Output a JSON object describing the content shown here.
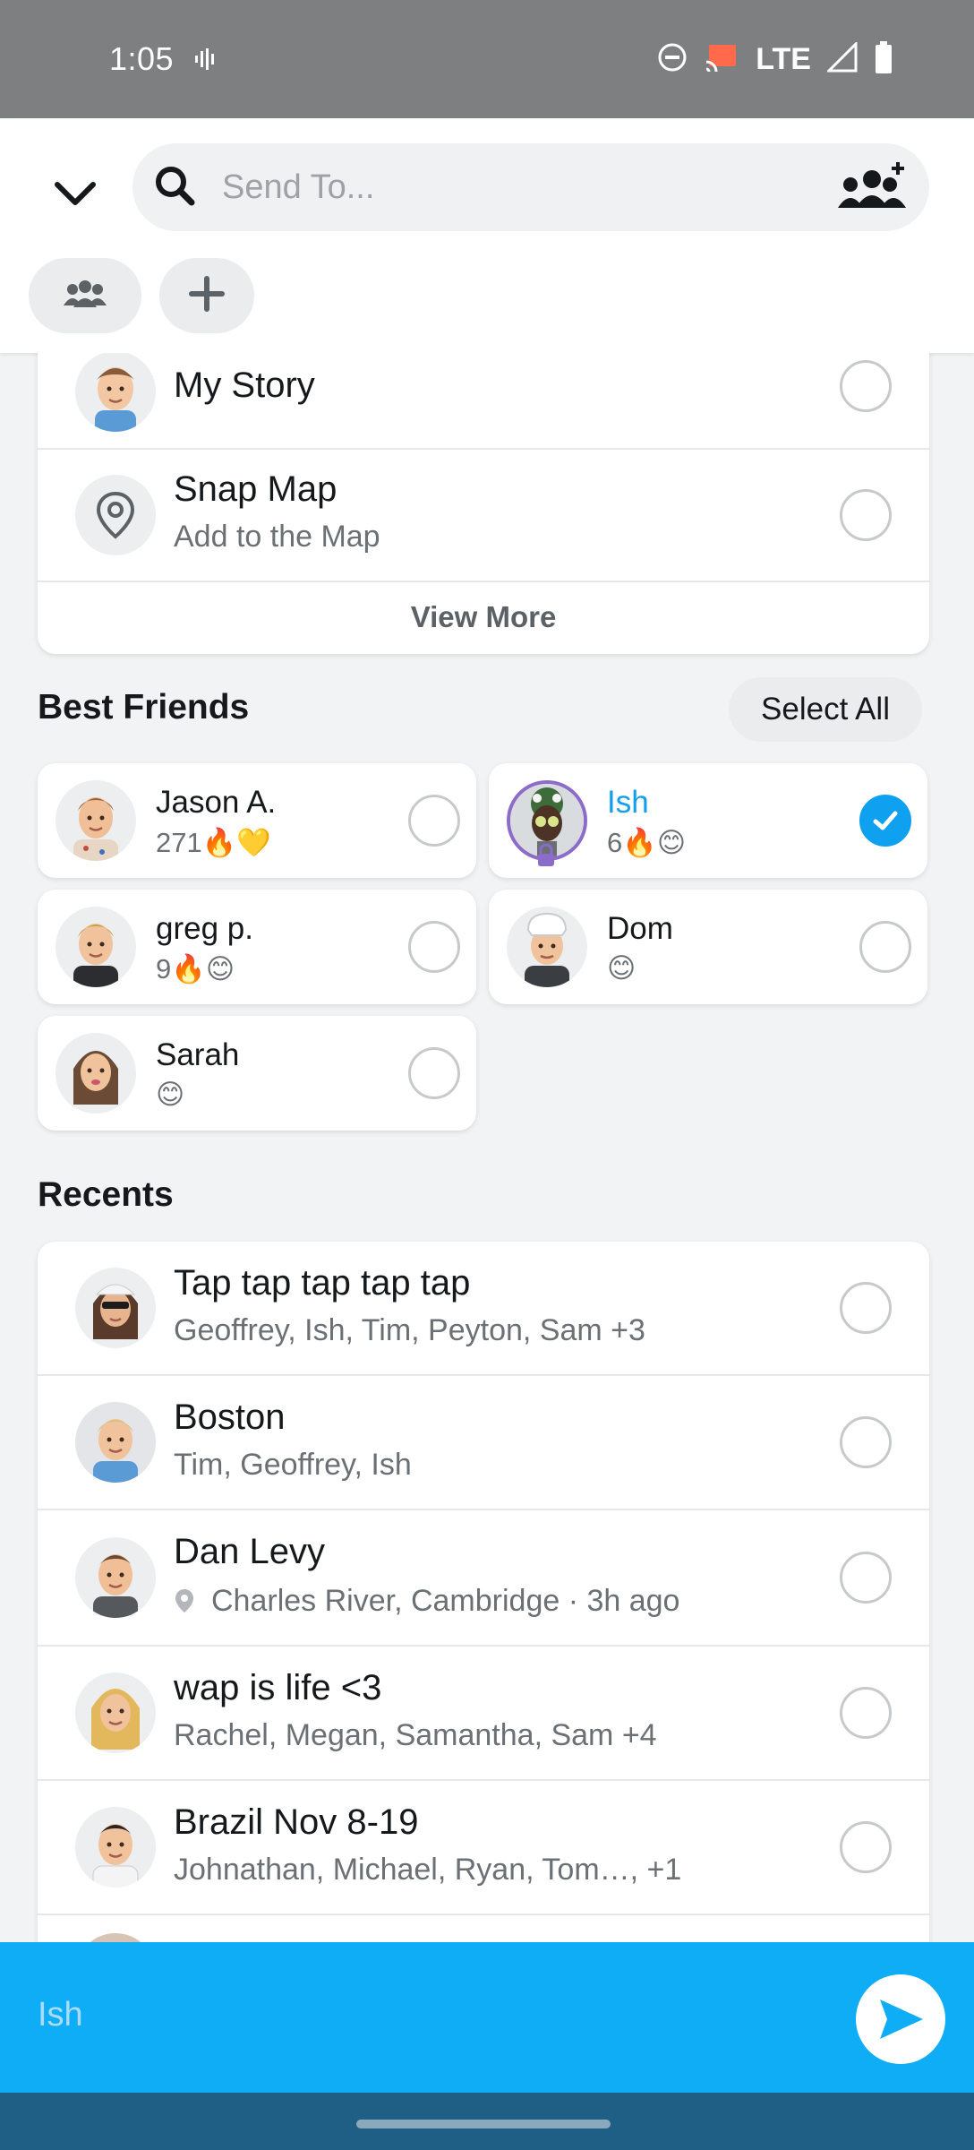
{
  "status_bar": {
    "time": "1:05",
    "network": "LTE",
    "icons": [
      "vibrate-icon",
      "do-not-disturb-icon",
      "cast-icon",
      "signal-icon",
      "battery-icon"
    ]
  },
  "header": {
    "search_placeholder": "Send To...",
    "icons": [
      "chevron-down-icon",
      "search-icon",
      "add-friends-icon",
      "group-icon",
      "plus-icon"
    ]
  },
  "stories": {
    "items": [
      {
        "title": "My Story",
        "subtitle": ""
      },
      {
        "title": "Snap Map",
        "subtitle": "Add to the Map"
      }
    ],
    "view_more": "View More"
  },
  "best_friends": {
    "title": "Best Friends",
    "select_all": "Select All",
    "items": [
      {
        "name": "Jason A.",
        "meta": "271🔥💛",
        "selected": false
      },
      {
        "name": "Ish",
        "meta": "6🔥😊",
        "selected": true
      },
      {
        "name": "greg p.",
        "meta": "9🔥😊",
        "selected": false
      },
      {
        "name": "Dom",
        "meta": "😊",
        "selected": false
      },
      {
        "name": "Sarah",
        "meta": "😊",
        "selected": false
      }
    ]
  },
  "recents": {
    "title": "Recents",
    "items": [
      {
        "title": "Tap tap tap tap tap",
        "subtitle": "Geoffrey, Ish, Tim, Peyton, Sam +3"
      },
      {
        "title": "Boston",
        "subtitle": "Tim, Geoffrey, Ish"
      },
      {
        "title": "Dan Levy",
        "subtitle": "Charles River, Cambridge · 3h ago"
      },
      {
        "title": "wap is life <3",
        "subtitle": "Rachel, Megan, Samantha, Sam +4"
      },
      {
        "title": "Brazil Nov 8-19",
        "subtitle": "Johnathan, Michael, Ryan, Tom…, +1"
      }
    ]
  },
  "send_bar": {
    "recipients": "Ish"
  },
  "colors": {
    "accent": "#0fadf5",
    "selected_text": "#0fa0f0",
    "status_bar": "#7e7f81"
  }
}
